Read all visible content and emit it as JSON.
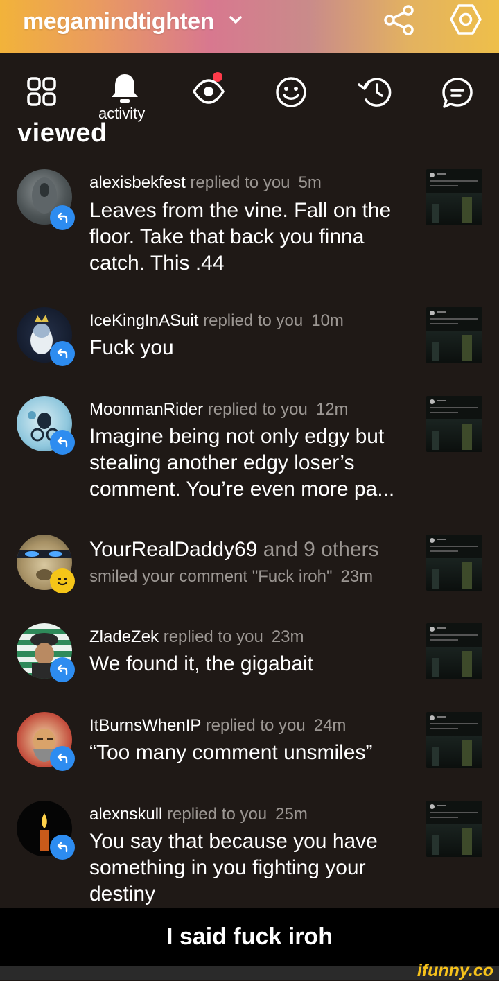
{
  "header": {
    "profile_name": "megamindtighten",
    "colors": {
      "gradient_start": "#f2b33a",
      "gradient_mid": "#d8788f",
      "gradient_end": "#eebf4a"
    },
    "icons": [
      "chevron-down-icon",
      "share-icon",
      "settings-hexagon-icon"
    ]
  },
  "tabs": {
    "active_label": "activity",
    "items": [
      "grid-icon",
      "bell-icon",
      "eye-icon",
      "smile-icon",
      "history-icon",
      "chat-icon"
    ]
  },
  "section_title": "viewed",
  "notifications": [
    {
      "user": "alexisbekfest",
      "action": "replied to you",
      "time": "5m",
      "text": "Leaves from the vine. Fall on the floor. Take that back you finna catch. This .44",
      "badge": "reply"
    },
    {
      "user": "IceKingInASuit",
      "action": "replied to you",
      "time": "10m",
      "text": "Fuck you",
      "badge": "reply"
    },
    {
      "user": "MoonmanRider",
      "action": "replied to you",
      "time": "12m",
      "text": "Imagine being not only edgy but stealing another edgy loser’s comment. You’re even more pa...",
      "badge": "reply"
    },
    {
      "user": "YourRealDaddy69",
      "others": "and 9 others",
      "action": "smiled your comment \"Fuck iroh\"",
      "time": "23m",
      "badge": "smile"
    },
    {
      "user": "ZladeZek",
      "action": "replied to you",
      "time": "23m",
      "text": "We found it, the gigabait",
      "badge": "reply"
    },
    {
      "user": "ItBurnsWhenIP",
      "action": "replied to you",
      "time": "24m",
      "text": "“Too many comment unsmiles”",
      "badge": "reply"
    },
    {
      "user": "alexnskull",
      "action": "replied to you",
      "time": "25m",
      "text": "You say that because you have something in you fighting your destiny",
      "badge": "reply"
    }
  ],
  "caption": "I said fuck iroh",
  "watermark": "ifunny.co"
}
